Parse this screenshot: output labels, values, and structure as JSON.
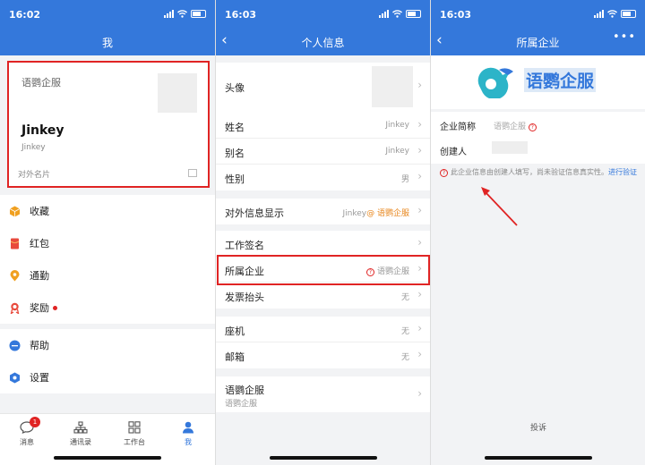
{
  "status": {
    "time": "16:03",
    "time_first": "16:02"
  },
  "screen1": {
    "title": "我",
    "card": {
      "company": "语鹦企服",
      "name": "Jinkey",
      "sub": "Jinkey",
      "footer": "对外名片"
    },
    "menu": [
      {
        "label": "收藏",
        "icon": "cube-icon",
        "color": "#f0a020"
      },
      {
        "label": "红包",
        "icon": "red-envelope-icon",
        "color": "#e84a3c"
      },
      {
        "label": "通勤",
        "icon": "location-pin-icon",
        "color": "#f0a020"
      },
      {
        "label": "奖励",
        "icon": "medal-icon",
        "color": "#e84a3c",
        "dot": true
      },
      {
        "label": "帮助",
        "icon": "help-chat-icon",
        "color": "#3478db"
      },
      {
        "label": "设置",
        "icon": "gear-icon",
        "color": "#3478db"
      }
    ],
    "tabs": [
      {
        "label": "消息",
        "badge": "1"
      },
      {
        "label": "通讯录"
      },
      {
        "label": "工作台"
      },
      {
        "label": "我",
        "active": true
      }
    ]
  },
  "screen2": {
    "title": "个人信息",
    "rows": {
      "avatar": "头像",
      "name": {
        "label": "姓名",
        "value": "Jinkey"
      },
      "alias": {
        "label": "别名",
        "value": "Jinkey"
      },
      "gender": {
        "label": "性别",
        "value": "男"
      },
      "external": {
        "label": "对外信息显示",
        "value_main": "Jinkey",
        "value_suffix": "@ 语鹦企服"
      },
      "signature": {
        "label": "工作签名"
      },
      "company": {
        "label": "所属企业",
        "value": "语鹦企服"
      },
      "invoice": {
        "label": "发票抬头",
        "value": "无"
      },
      "landline": {
        "label": "座机",
        "value": "无"
      },
      "email": {
        "label": "邮箱",
        "value": "无"
      },
      "org": {
        "label": "语鹦企服",
        "sub": "语鹦企服"
      }
    }
  },
  "screen3": {
    "title": "所属企业",
    "logo_text": "语鹦企服",
    "short_name_label": "企业简称",
    "short_name_value": "语鹦企服",
    "creator_label": "创建人",
    "notice": "此企业信息由创建人填写，尚未验证信息真实性。",
    "notice_link": "进行验证",
    "complain": "投诉"
  },
  "colors": {
    "brand": "#3478db",
    "alert": "#e02424",
    "accent": "#e8871e"
  }
}
